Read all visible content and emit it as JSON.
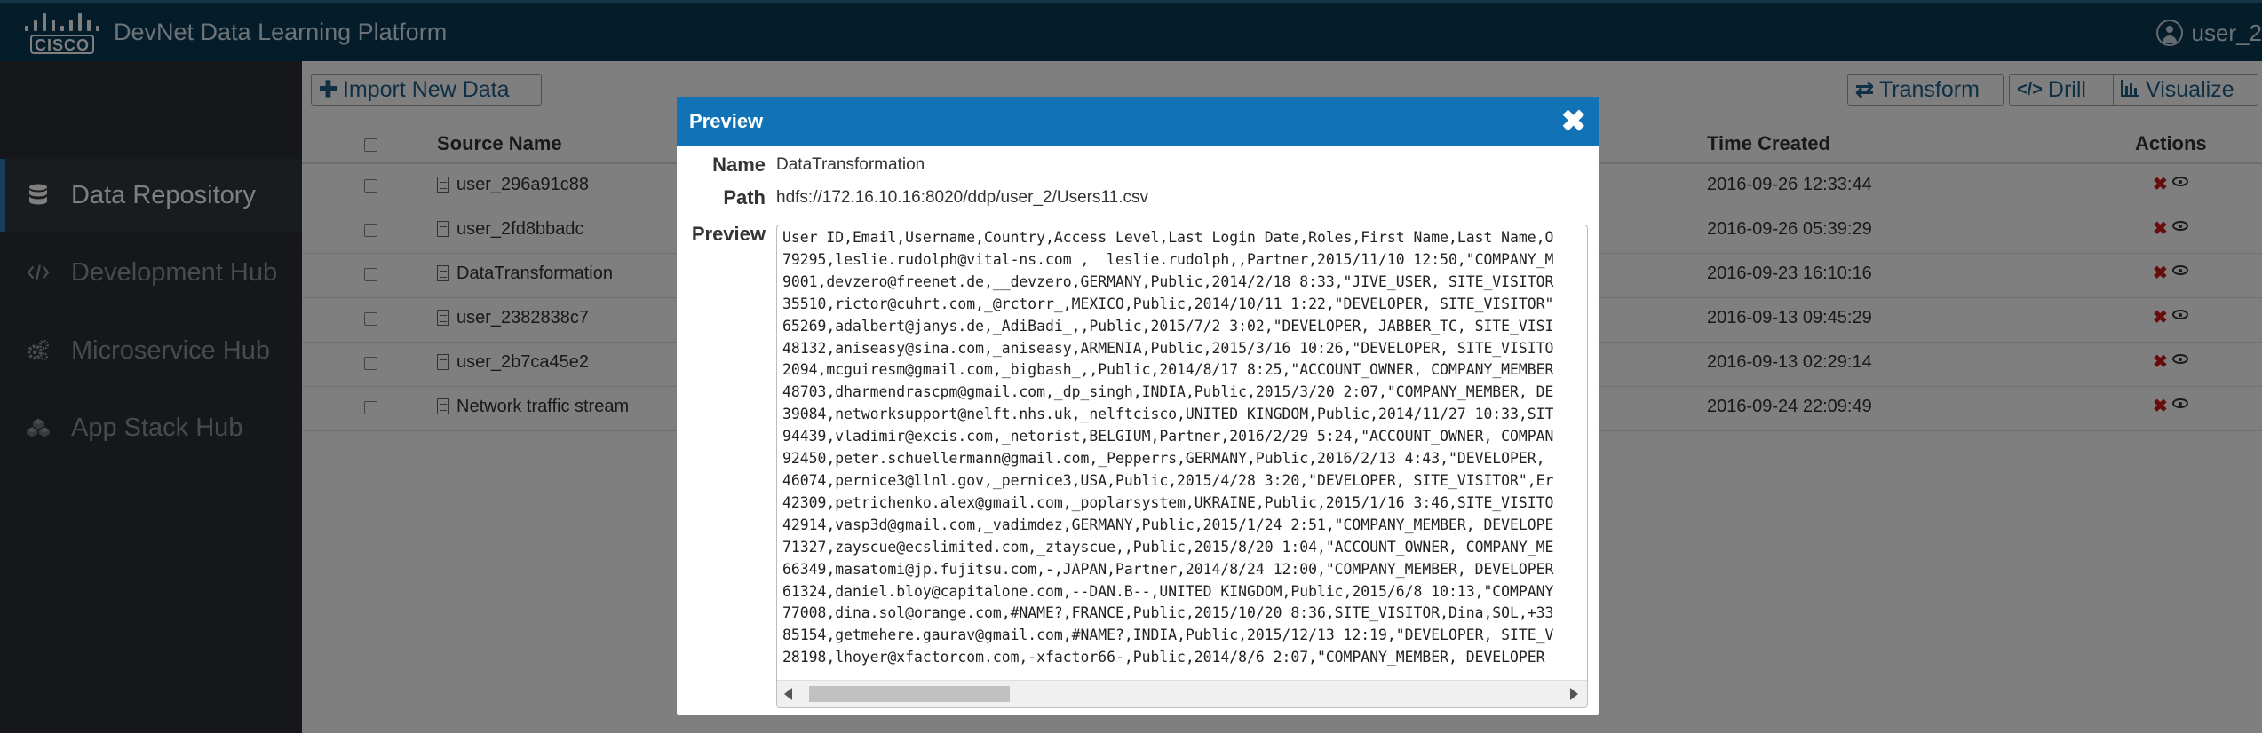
{
  "header": {
    "logo_text": "CISCO",
    "title": "DevNet Data Learning Platform",
    "user": "user_2",
    "user_icon": "user-circle-icon",
    "bg_color": "#0b3a57"
  },
  "sidebar": {
    "items": [
      {
        "label": "Data Repository",
        "icon": "database-icon",
        "active": true
      },
      {
        "label": "Development Hub",
        "icon": "code-icon",
        "active": false
      },
      {
        "label": "Microservice Hub",
        "icon": "cogs-icon",
        "active": false
      },
      {
        "label": "App Stack Hub",
        "icon": "cubes-icon",
        "active": false
      }
    ]
  },
  "toolbar": {
    "import_label": "Import New Data",
    "transform_label": "Transform",
    "drill_label": "Drill",
    "visualize_label": "Visualize"
  },
  "table": {
    "headers": {
      "source": "Source Name",
      "time": "Time Created",
      "actions": "Actions"
    },
    "rows": [
      {
        "source": "user_296a91c88",
        "time": "2016-09-26 12:33:44"
      },
      {
        "source": "user_2fd8bbadc",
        "time": "2016-09-26 05:39:29"
      },
      {
        "source": "DataTransformation",
        "time": "2016-09-23 16:10:16"
      },
      {
        "source": "user_2382838c7",
        "time": "2016-09-13 09:45:29"
      },
      {
        "source": "user_2b7ca45e2",
        "time": "2016-09-13 02:29:14"
      },
      {
        "source": "Network traffic stream",
        "time": "2016-09-24 22:09:49"
      }
    ]
  },
  "modal": {
    "title": "Preview",
    "close": "✖",
    "name_label": "Name",
    "name_value": "DataTransformation",
    "path_label": "Path",
    "path_value": "hdfs://172.16.10.16:8020/ddp/user_2/Users11.csv",
    "preview_label": "Preview",
    "header_color": "#1173b6",
    "preview_lines": [
      "User ID,Email,Username,Country,Access Level,Last Login Date,Roles,First Name,Last Name,O",
      "79295,leslie.rudolph@vital-ns.com ,  leslie.rudolph,,Partner,2015/11/10 12:50,\"COMPANY_M",
      "9001,devzero@freenet.de,__devzero,GERMANY,Public,2014/2/18 8:33,\"JIVE_USER, SITE_VISITOR",
      "35510,rictor@cuhrt.com,_@rctorr_,MEXICO,Public,2014/10/11 1:22,\"DEVELOPER, SITE_VISITOR\"",
      "65269,adalbert@janys.de,_AdiBadi_,,Public,2015/7/2 3:02,\"DEVELOPER, JABBER_TC, SITE_VISI",
      "48132,aniseasy@sina.com,_aniseasy,ARMENIA,Public,2015/3/16 10:26,\"DEVELOPER, SITE_VISITO",
      "2094,mcguiresm@gmail.com,_bigbash_,,Public,2014/8/17 8:25,\"ACCOUNT_OWNER, COMPANY_MEMBER",
      "48703,dharmendrascpm@gmail.com,_dp_singh,INDIA,Public,2015/3/20 2:07,\"COMPANY_MEMBER, DE",
      "39084,networksupport@nelft.nhs.uk,_nelftcisco,UNITED KINGDOM,Public,2014/11/27 10:33,SIT",
      "94439,vladimir@excis.com,_netorist,BELGIUM,Partner,2016/2/29 5:24,\"ACCOUNT_OWNER, COMPAN",
      "92450,peter.schuellermann@gmail.com,_Pepperrs,GERMANY,Public,2016/2/13 4:43,\"DEVELOPER, ",
      "46074,pernice3@llnl.gov,_pernice3,USA,Public,2015/4/28 3:20,\"DEVELOPER, SITE_VISITOR\",Er",
      "42309,petrichenko.alex@gmail.com,_poplarsystem,UKRAINE,Public,2015/1/16 3:46,SITE_VISITO",
      "42914,vasp3d@gmail.com,_vadimdez,GERMANY,Public,2015/1/24 2:51,\"COMPANY_MEMBER, DEVELOPE",
      "71327,zayscue@ecslimited.com,_ztayscue,,Public,2015/8/20 1:04,\"ACCOUNT_OWNER, COMPANY_ME",
      "66349,masatomi@jp.fujitsu.com,-,JAPAN,Partner,2014/8/24 12:00,\"COMPANY_MEMBER, DEVELOPER",
      "61324,daniel.bloy@capitalone.com,--DAN.B--,UNITED KINGDOM,Public,2015/6/8 10:13,\"COMPANY",
      "77008,dina.sol@orange.com,#NAME?,FRANCE,Public,2015/10/20 8:36,SITE_VISITOR,Dina,SOL,+33",
      "85154,getmehere.gaurav@gmail.com,#NAME?,INDIA,Public,2015/12/13 12:19,\"DEVELOPER, SITE_V",
      "28198,lhoyer@xfactorcom.com,-xfactor66-,Public,2014/8/6 2:07,\"COMPANY_MEMBER, DEVELOPER"
    ]
  }
}
